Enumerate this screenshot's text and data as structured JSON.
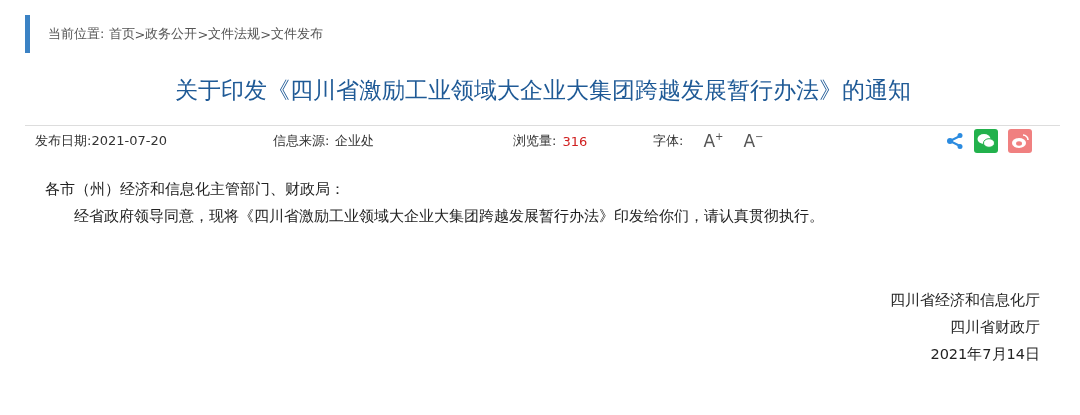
{
  "breadcrumb": {
    "label": "当前位置:",
    "separator": ">",
    "items": [
      "首页",
      "政务公开",
      "文件法规",
      "文件发布"
    ]
  },
  "title": "关于印发《四川省激励工业领域大企业大集团跨越发展暂行办法》的通知",
  "meta": {
    "date": "发布日期:2021-07-20",
    "source_label": "信息来源:",
    "source": "企业处",
    "views_label": "浏览量:",
    "views": "316",
    "font_label": "字体:",
    "font_buttons": [
      "A$^{+}$",
      "A$^{−}$"
    ]
  },
  "body": {
    "salutation": "各市（州）经济和信息化主管部门、财政局：",
    "paragraphs": [
      "经省政府领导同意，现将《四川省激励工业领域大企业大集团跨越发展暂行办法》印发给你们，请认真贯彻执行。"
    ]
  },
  "signature": [
    "四川省经济和信息化厅",
    "四川省财政厅",
    "2021年7月14日"
  ]
}
